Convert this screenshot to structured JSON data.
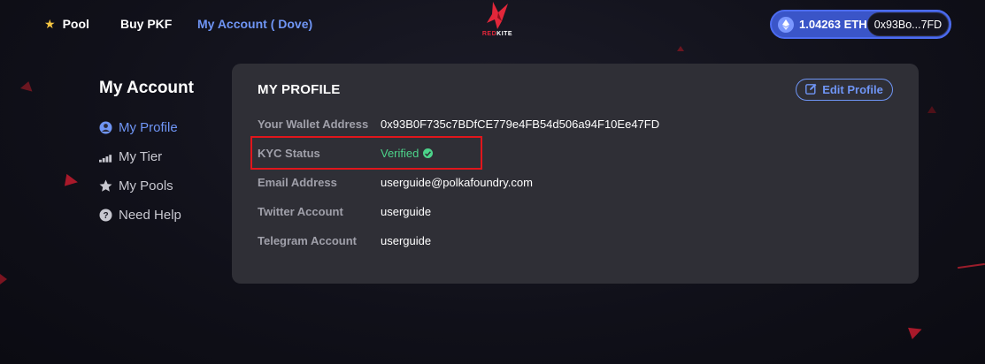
{
  "nav": {
    "pool_label": "Pool",
    "buy_label": "Buy PKF",
    "account_label": "My Account ( Dove)",
    "logo_text_red": "RED",
    "logo_text_white": "KITE"
  },
  "wallet": {
    "balance": "1.04263 ETH",
    "address_short": "0x93Bo...7FD"
  },
  "sidebar": {
    "title": "My Account",
    "items": [
      {
        "label": "My Profile",
        "icon": "user-circle-icon",
        "active": true
      },
      {
        "label": "My Tier",
        "icon": "signal-bars-icon",
        "active": false
      },
      {
        "label": "My Pools",
        "icon": "star-icon",
        "active": false
      },
      {
        "label": "Need Help",
        "icon": "question-icon",
        "active": false
      }
    ]
  },
  "profile": {
    "title": "MY PROFILE",
    "edit_label": "Edit Profile",
    "rows": [
      {
        "label": "Your Wallet Address",
        "value": "0x93B0F735c7BDfCE779e4FB54d506a94F10Ee47FD"
      },
      {
        "label": "KYC Status",
        "value": "Verified"
      },
      {
        "label": "Email Address",
        "value": "userguide@polkafoundry.com"
      },
      {
        "label": "Twitter Account",
        "value": "userguide"
      },
      {
        "label": "Telegram Account",
        "value": "userguide"
      }
    ]
  },
  "colors": {
    "accent": "#6f95f5",
    "verified": "#4cd38a",
    "highlight": "#e0161c",
    "brand_red": "#e2273a"
  }
}
